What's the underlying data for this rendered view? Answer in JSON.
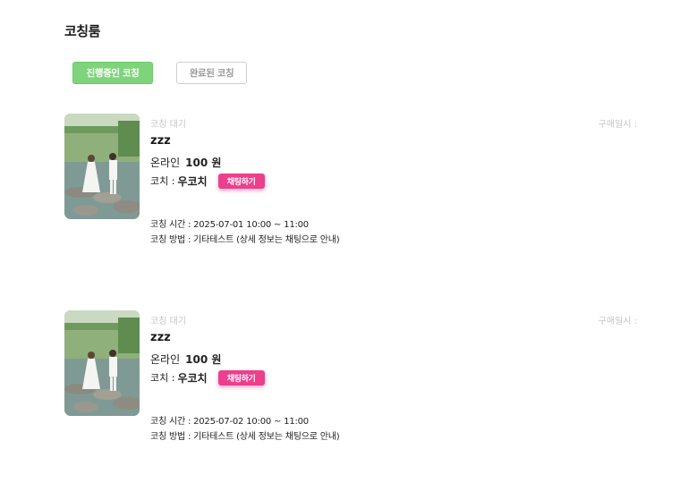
{
  "page": {
    "title": "코칭룸"
  },
  "tabs": [
    {
      "label": "진행중인 코칭",
      "active": true
    },
    {
      "label": "완료된 코칭",
      "active": false
    }
  ],
  "colors": {
    "tab_active": "#7fd47b",
    "chat_button": "#ec3f8c",
    "muted_text": "#c4c4c4"
  },
  "sessions": [
    {
      "status": "코칭 대기",
      "purchase_date": "구매일시 :",
      "product_name": "zzz",
      "type": "온라인",
      "price": "100 원",
      "coach_label": "코치 :",
      "coach_name": "우코치",
      "chat_button_label": "채팅하기",
      "time": "코칭 시간 : 2025-07-01 10:00 ~ 11:00",
      "method": "코칭 방법 : 기타테스트 (상세 정보는 채팅으로 안내)"
    },
    {
      "status": "코칭 대기",
      "purchase_date": "구매일시 :",
      "product_name": "zzz",
      "type": "온라인",
      "price": "100 원",
      "coach_label": "코치 :",
      "coach_name": "우코치",
      "chat_button_label": "채팅하기",
      "time": "코칭 시간 : 2025-07-02 10:00 ~ 11:00",
      "method": "코칭 방법 : 기타테스트 (상세 정보는 채팅으로 안내)"
    }
  ]
}
